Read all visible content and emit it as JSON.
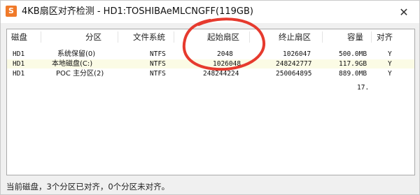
{
  "window": {
    "app_icon_glyph": "S",
    "title": "4KB扇区对齐检测 - HD1:TOSHIBAeMLCNGFF(119GB)",
    "close_glyph": "✕"
  },
  "table": {
    "headers": {
      "disk": "磁盘",
      "partition": "分区",
      "fs": "文件系统",
      "start": "起始扇区",
      "end": "终止扇区",
      "capacity": "容量",
      "aligned": "对齐"
    },
    "rows": [
      {
        "disk": "HD1",
        "partition": "系统保留(0)",
        "fs": "NTFS",
        "start": "2048",
        "end": "1026047",
        "capacity": "500.0MB",
        "aligned": "Y"
      },
      {
        "disk": "HD1",
        "partition": "本地磁盘(C:)",
        "fs": "NTFS",
        "start": "1026048",
        "end": "248242777",
        "capacity": "117.9GB",
        "aligned": "Y"
      },
      {
        "disk": "HD1",
        "partition": "POC 主分区(2)",
        "fs": "NTFS",
        "start": "248244224",
        "end": "250064895",
        "capacity": "889.0MB",
        "aligned": "Y"
      }
    ],
    "overflow_text": "17."
  },
  "status": {
    "text": "当前磁盘，3个分区已对齐，0个分区未对齐。"
  },
  "colors": {
    "annotation": "#e63a2e",
    "row_highlight": "#fbfbe5",
    "icon_bg": "#f07a2a"
  }
}
